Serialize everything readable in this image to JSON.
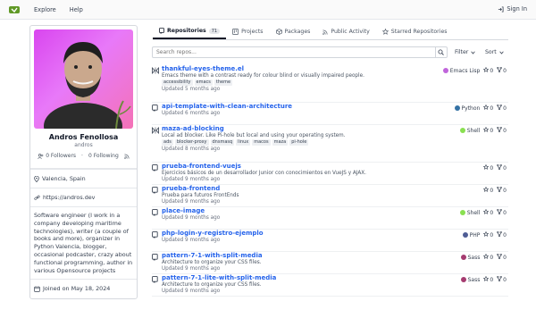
{
  "nav": {
    "explore": "Explore",
    "help": "Help",
    "signin": "Sign In"
  },
  "profile": {
    "name": "Andros Fenollosa",
    "username": "andros",
    "followers": "0 Followers",
    "following": "0 Following",
    "location": "Valencia, Spain",
    "website": "https://andros.dev",
    "bio": "Software engineer (I work in a company developing maritime technologies), writer (a couple of books and more), organizer in Python Valencia, blogger, occasional podcaster, crazy about functional programming, author in various Opensource projects",
    "joined": "Joined on May 18, 2024"
  },
  "tabs": [
    {
      "label": "Repositories",
      "count": "71"
    },
    {
      "label": "Projects"
    },
    {
      "label": "Packages"
    },
    {
      "label": "Public Activity"
    },
    {
      "label": "Starred Repositories"
    }
  ],
  "search": {
    "placeholder": "Search repos...",
    "filter": "Filter",
    "sort": "Sort"
  },
  "repos": [
    {
      "name": "thankful-eyes-theme.el",
      "desc": "Emacs theme with a contrast ready for colour blind or visually impaired people.",
      "topics": [
        "accessibility",
        "emacs",
        "theme"
      ],
      "updated": "Updated 5 months ago",
      "lang": "Emacs Lisp",
      "color": "#c065db",
      "stars": "0",
      "forks": "0",
      "icon": "mirror"
    },
    {
      "name": "api-template-with-clean-architecture",
      "desc": "",
      "topics": [],
      "updated": "Updated 6 months ago",
      "lang": "Python",
      "color": "#3572a5",
      "stars": "0",
      "forks": "0",
      "icon": "repo"
    },
    {
      "name": "maza-ad-blocking",
      "desc": "Local ad blocker. Like Pi-hole but local and using your operating system.",
      "topics": [
        "ads",
        "blocker-proxy",
        "dnsmasq",
        "linux",
        "macos",
        "maza",
        "pi-hole"
      ],
      "updated": "Updated 8 months ago",
      "lang": "Shell",
      "color": "#89e051",
      "stars": "0",
      "forks": "0",
      "icon": "mirror"
    },
    {
      "name": "prueba-frontend-vuejs",
      "desc": "Ejercicios básicos de un desarrollador Junior con conocimientos en VueJS y AJAX.",
      "topics": [],
      "updated": "Updated 9 months ago",
      "lang": "",
      "color": "",
      "stars": "0",
      "forks": "0",
      "icon": "repo"
    },
    {
      "name": "prueba-frontend",
      "desc": "Prueba para futuros FrontEnds",
      "topics": [],
      "updated": "Updated 9 months ago",
      "lang": "",
      "color": "",
      "stars": "0",
      "forks": "0",
      "icon": "repo"
    },
    {
      "name": "place-image",
      "desc": "",
      "topics": [],
      "updated": "Updated 9 months ago",
      "lang": "Shell",
      "color": "#89e051",
      "stars": "0",
      "forks": "0",
      "icon": "repo"
    },
    {
      "name": "php-login-y-registro-ejemplo",
      "desc": "",
      "topics": [],
      "updated": "Updated 9 months ago",
      "lang": "PHP",
      "color": "#4f5d95",
      "stars": "0",
      "forks": "0",
      "icon": "repo"
    },
    {
      "name": "pattern-7-1-with-split-media",
      "desc": "Architecture to organize your CSS files.",
      "topics": [],
      "updated": "Updated 9 months ago",
      "lang": "Sass",
      "color": "#a53b70",
      "stars": "0",
      "forks": "0",
      "icon": "repo"
    },
    {
      "name": "pattern-7-1-lite-with-split-media",
      "desc": "Architecture to organize your CSS files.",
      "topics": [],
      "updated": "Updated 9 months ago",
      "lang": "Sass",
      "color": "#a53b70",
      "stars": "0",
      "forks": "0",
      "icon": "repo"
    }
  ]
}
